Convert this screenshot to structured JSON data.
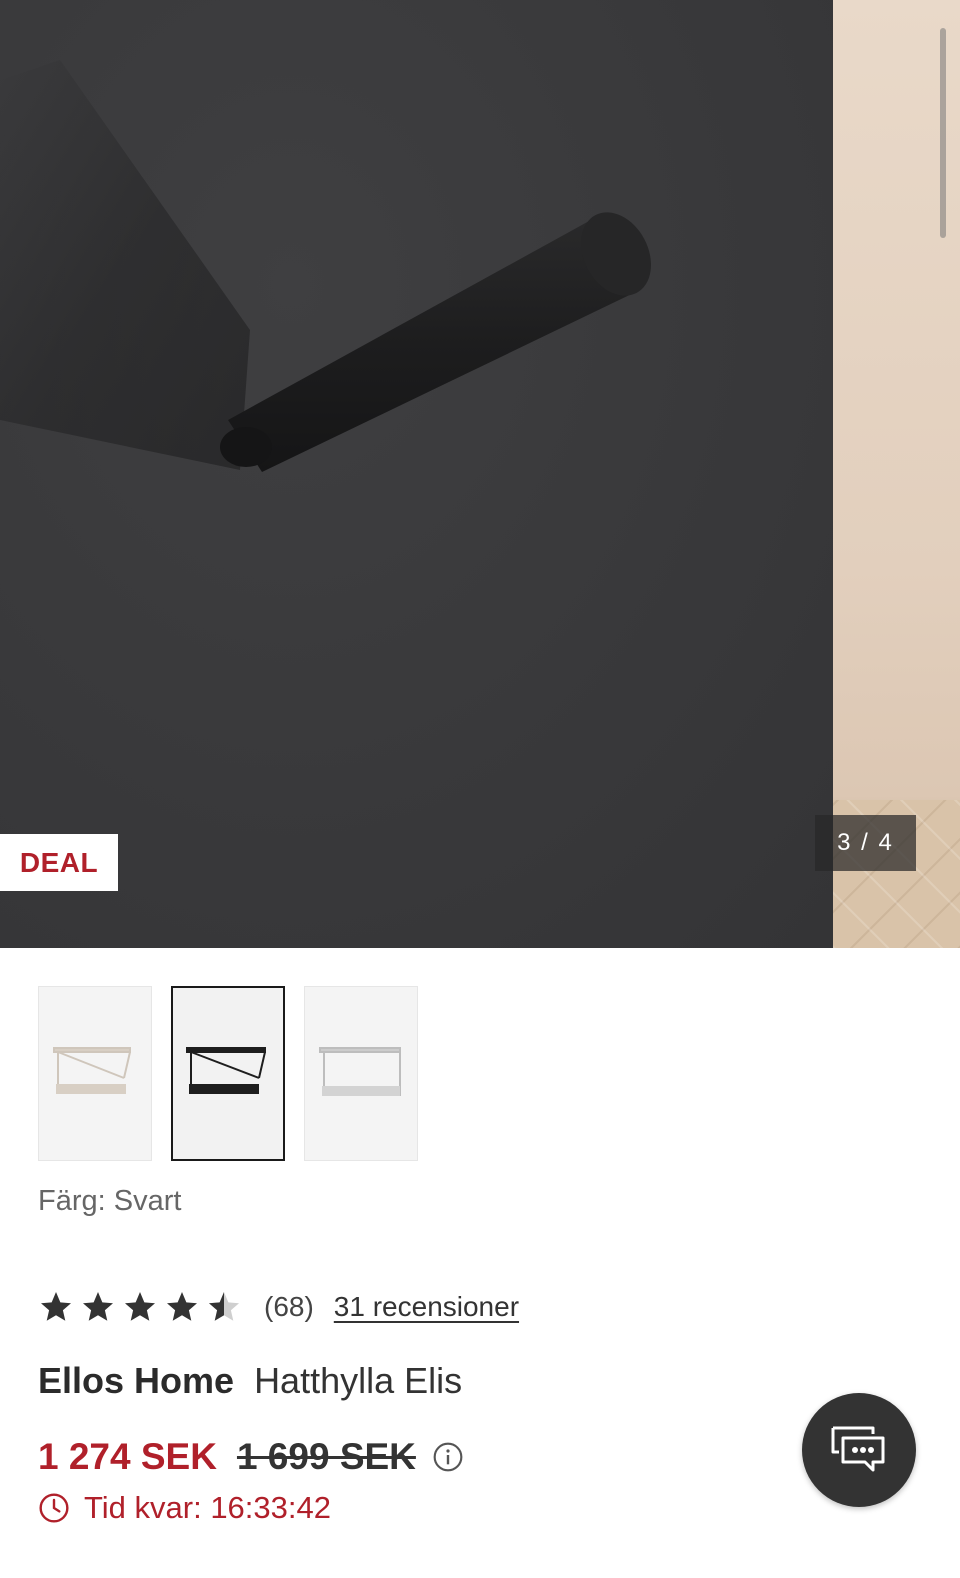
{
  "gallery": {
    "badge": "DEAL",
    "counter": "3 / 4",
    "current_slide": 3,
    "total_slides": 4
  },
  "thumbnails": [
    {
      "color": "beige",
      "selected": false
    },
    {
      "color": "black",
      "selected": true
    },
    {
      "color": "light-grey",
      "selected": false
    }
  ],
  "color_selection": {
    "label": "Färg: Svart"
  },
  "rating": {
    "value": 4.5,
    "max": 5,
    "count_text": "(68)",
    "reviews_link": "31 recensioner"
  },
  "product": {
    "brand": "Ellos Home",
    "name": "Hatthylla Elis"
  },
  "price": {
    "current": "1 274 SEK",
    "original": "1 699 SEK"
  },
  "deal_timer": {
    "text": "Tid kvar: 16:33:42"
  },
  "icons": {
    "info": "info-icon",
    "clock": "clock-icon",
    "chat": "chat-icon"
  },
  "colors": {
    "accent_red": "#b0202a",
    "text_dark": "#333333",
    "chat_bg": "#333333"
  }
}
